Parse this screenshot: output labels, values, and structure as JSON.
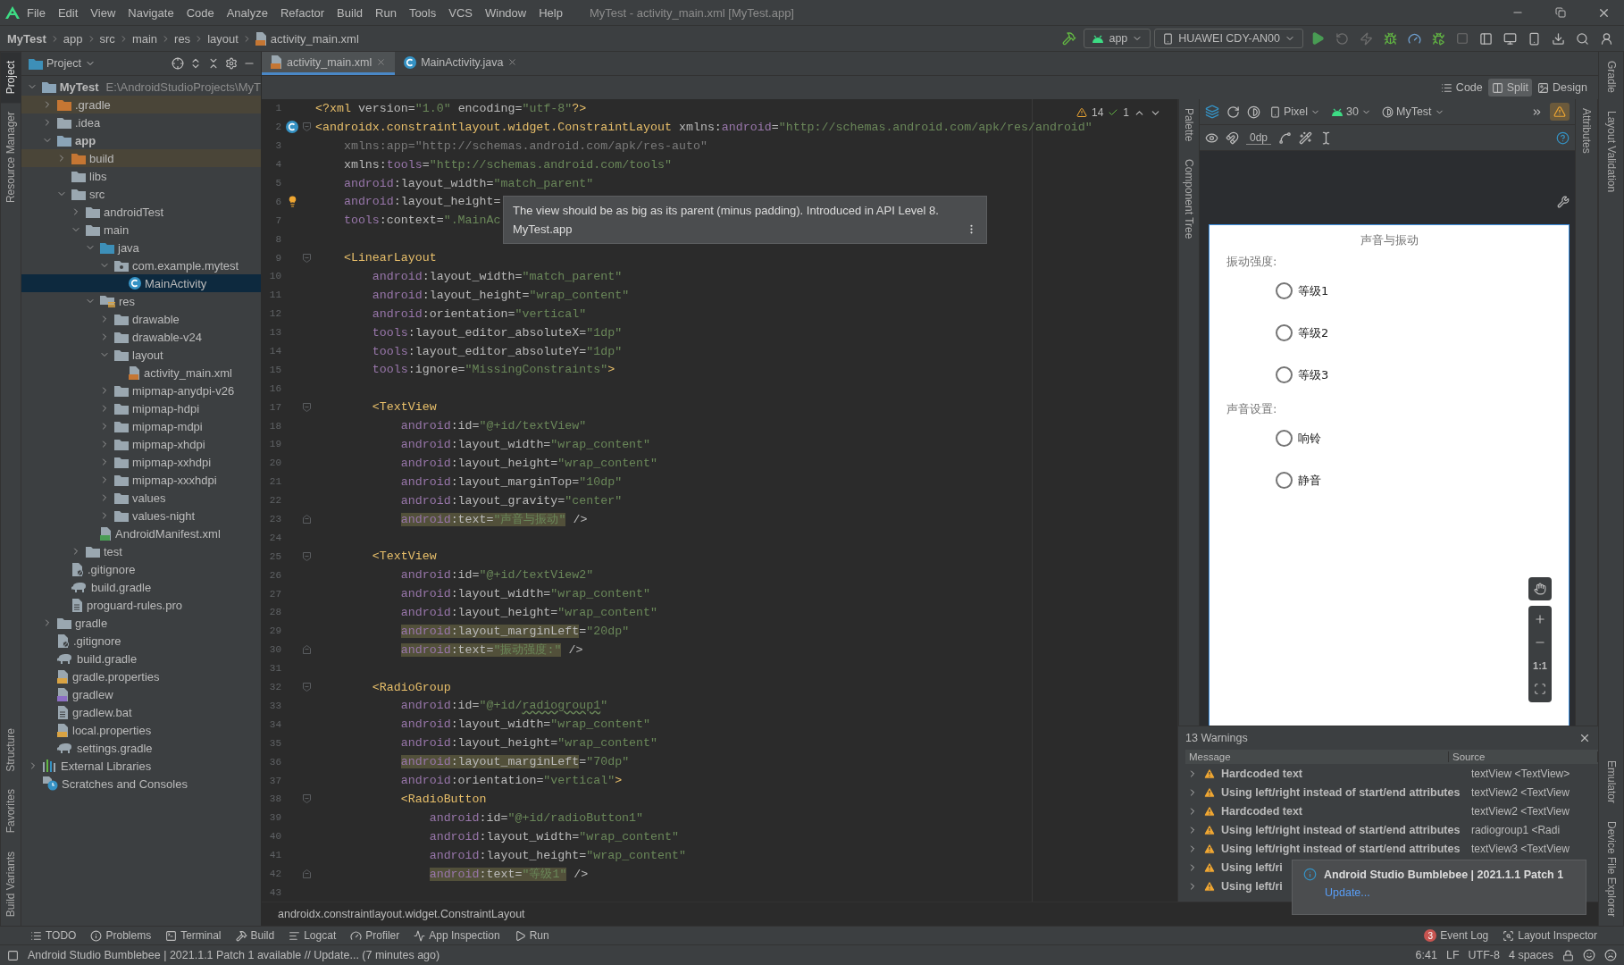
{
  "menu_bar": {
    "items": [
      "File",
      "Edit",
      "View",
      "Navigate",
      "Code",
      "Analyze",
      "Refactor",
      "Build",
      "Run",
      "Tools",
      "VCS",
      "Window",
      "Help"
    ],
    "title": "MyTest - activity_main.xml [MyTest.app]"
  },
  "nav_bar": {
    "breadcrumbs": [
      "MyTest",
      "app",
      "src",
      "main",
      "res",
      "layout",
      "activity_main.xml"
    ],
    "run_config": "app",
    "device": "HUAWEI CDY-AN00"
  },
  "left_stripe": {
    "top": [
      {
        "label": "Project",
        "selected": true
      },
      {
        "label": "Resource Manager",
        "selected": false
      }
    ],
    "bottom": [
      {
        "label": "Structure",
        "selected": false
      },
      {
        "label": "Favorites",
        "selected": false
      },
      {
        "label": "Build Variants",
        "selected": false
      }
    ]
  },
  "project": {
    "view": "Project",
    "tree": [
      {
        "label": "MyTest",
        "path": "E:\\AndroidStudioProjects\\MyT",
        "kind": "module",
        "selected": false,
        "expanded": true,
        "children": [
          {
            "label": ".gradle",
            "kind": "excluded",
            "selected": false,
            "expanded": false
          },
          {
            "label": ".idea",
            "kind": "folder",
            "selected": false,
            "expanded": false
          },
          {
            "label": "app",
            "kind": "module",
            "selected": false,
            "expanded": true,
            "children": [
              {
                "label": "build",
                "kind": "excluded",
                "selected": false,
                "expanded": false
              },
              {
                "label": "libs",
                "kind": "folder",
                "selected": false
              },
              {
                "label": "src",
                "kind": "folder",
                "selected": false,
                "expanded": true,
                "children": [
                  {
                    "label": "androidTest",
                    "kind": "folder",
                    "selected": false,
                    "expanded": false
                  },
                  {
                    "label": "main",
                    "kind": "folder",
                    "selected": false,
                    "expanded": true,
                    "children": [
                      {
                        "label": "java",
                        "kind": "source",
                        "selected": false,
                        "expanded": true,
                        "children": [
                          {
                            "label": "com.example.mytest",
                            "kind": "package",
                            "selected": false,
                            "expanded": true,
                            "children": [
                              {
                                "label": "MainActivity",
                                "kind": "class",
                                "selected": true
                              }
                            ]
                          }
                        ]
                      },
                      {
                        "label": "res",
                        "kind": "res",
                        "selected": false,
                        "expanded": true,
                        "children": [
                          {
                            "label": "drawable",
                            "kind": "folder",
                            "selected": false,
                            "expanded": false
                          },
                          {
                            "label": "drawable-v24",
                            "kind": "folder",
                            "selected": false,
                            "expanded": false
                          },
                          {
                            "label": "layout",
                            "kind": "folder",
                            "selected": false,
                            "expanded": true,
                            "children": [
                              {
                                "label": "activity_main.xml",
                                "kind": "xml",
                                "selected": false
                              }
                            ]
                          },
                          {
                            "label": "mipmap-anydpi-v26",
                            "kind": "folder",
                            "selected": false,
                            "expanded": false
                          },
                          {
                            "label": "mipmap-hdpi",
                            "kind": "folder",
                            "selected": false,
                            "expanded": false
                          },
                          {
                            "label": "mipmap-mdpi",
                            "kind": "folder",
                            "selected": false,
                            "expanded": false
                          },
                          {
                            "label": "mipmap-xhdpi",
                            "kind": "folder",
                            "selected": false,
                            "expanded": false
                          },
                          {
                            "label": "mipmap-xxhdpi",
                            "kind": "folder",
                            "selected": false,
                            "expanded": false
                          },
                          {
                            "label": "mipmap-xxxhdpi",
                            "kind": "folder",
                            "selected": false,
                            "expanded": false
                          },
                          {
                            "label": "values",
                            "kind": "folder",
                            "selected": false,
                            "expanded": false
                          },
                          {
                            "label": "values-night",
                            "kind": "folder",
                            "selected": false,
                            "expanded": false
                          }
                        ]
                      },
                      {
                        "label": "AndroidManifest.xml",
                        "kind": "manifest",
                        "selected": false
                      }
                    ]
                  },
                  {
                    "label": "test",
                    "kind": "folder",
                    "selected": false,
                    "expanded": false
                  }
                ]
              },
              {
                "label": ".gitignore",
                "kind": "gitignore",
                "selected": false
              },
              {
                "label": "build.gradle",
                "kind": "gradle",
                "selected": false
              },
              {
                "label": "proguard-rules.pro",
                "kind": "text",
                "selected": false
              }
            ]
          },
          {
            "label": "gradle",
            "kind": "folder",
            "selected": false,
            "expanded": false
          },
          {
            "label": ".gitignore",
            "kind": "gitignore",
            "selected": false
          },
          {
            "label": "build.gradle",
            "kind": "gradle",
            "selected": false
          },
          {
            "label": "gradle.properties",
            "kind": "properties",
            "selected": false
          },
          {
            "label": "gradlew",
            "kind": "script",
            "selected": false
          },
          {
            "label": "gradlew.bat",
            "kind": "text",
            "selected": false
          },
          {
            "label": "local.properties",
            "kind": "properties",
            "selected": false
          },
          {
            "label": "settings.gradle",
            "kind": "gradle",
            "selected": false
          }
        ]
      },
      {
        "label": "External Libraries",
        "kind": "libraries",
        "selected": false,
        "expanded": false
      },
      {
        "label": "Scratches and Consoles",
        "kind": "scratches",
        "selected": false
      }
    ]
  },
  "editor": {
    "tabs": [
      {
        "label": "activity_main.xml",
        "kind": "xml",
        "selected": true
      },
      {
        "label": "MainActivity.java",
        "kind": "class",
        "selected": false
      }
    ],
    "modes": [
      {
        "label": "Code",
        "kind": "code",
        "selected": false
      },
      {
        "label": "Split",
        "kind": "split",
        "selected": true
      },
      {
        "label": "Design",
        "kind": "design",
        "selected": false
      }
    ],
    "inspections": {
      "warnings": "14",
      "passed": "1"
    },
    "lines": [
      {
        "number": "1",
        "tokens": [
          {
            "kind": "tag",
            "text": "<?xml"
          },
          {
            "kind": "attr",
            "text": " version="
          },
          {
            "kind": "str",
            "text": "\"1.0\""
          },
          {
            "kind": "attr",
            "text": " encoding="
          },
          {
            "kind": "str",
            "text": "\"utf-8\""
          },
          {
            "kind": "tag",
            "text": "?>"
          }
        ]
      },
      {
        "number": "2",
        "gutter": {
          "kind": "class"
        },
        "fold": {
          "kind": "start"
        },
        "tokens": [
          {
            "kind": "tag",
            "text": "<androidx.constraintlayout.widget.ConstraintLayout"
          },
          {
            "kind": "attr",
            "text": " xmlns:"
          },
          {
            "kind": "ns",
            "text": "android"
          },
          {
            "kind": "attr",
            "text": "="
          },
          {
            "kind": "str",
            "text": "\"http://schemas.android.com/apk/res/android\""
          }
        ]
      },
      {
        "number": "3",
        "tokens": [
          {
            "kind": "dim",
            "text": "    xmlns:app=\"http://schemas.android.com/apk/res-auto\""
          }
        ]
      },
      {
        "number": "4",
        "tokens": [
          {
            "kind": "attr",
            "text": "    xmlns:"
          },
          {
            "kind": "ns",
            "text": "tools"
          },
          {
            "kind": "attr",
            "text": "="
          },
          {
            "kind": "str",
            "text": "\"http://schemas.android.com/tools\""
          }
        ]
      },
      {
        "number": "5",
        "tokens": [
          {
            "kind": "ns",
            "text": "    android"
          },
          {
            "kind": "attr",
            "text": ":layout_width="
          },
          {
            "kind": "str",
            "text": "\"match_parent\""
          }
        ]
      },
      {
        "number": "6",
        "gutter": {
          "kind": "bulb"
        },
        "tokens": [
          {
            "kind": "ns",
            "text": "    android"
          },
          {
            "kind": "attr",
            "text": ":layout_height="
          }
        ]
      },
      {
        "number": "7",
        "tokens": [
          {
            "kind": "ns",
            "text": "    tools"
          },
          {
            "kind": "attr",
            "text": ":context="
          },
          {
            "kind": "str",
            "text": "\".MainAc"
          }
        ]
      },
      {
        "number": "8"
      },
      {
        "number": "9",
        "fold": {
          "kind": "start"
        },
        "tokens": [
          {
            "kind": "tag",
            "text": "    <LinearLayout"
          }
        ]
      },
      {
        "number": "10",
        "tokens": [
          {
            "kind": "ns",
            "text": "        android"
          },
          {
            "kind": "attr",
            "text": ":layout_width="
          },
          {
            "kind": "str",
            "text": "\"match_parent\""
          }
        ]
      },
      {
        "number": "11",
        "tokens": [
          {
            "kind": "ns",
            "text": "        android"
          },
          {
            "kind": "attr",
            "text": ":layout_height="
          },
          {
            "kind": "str",
            "text": "\"wrap_content\""
          }
        ]
      },
      {
        "number": "12",
        "tokens": [
          {
            "kind": "ns",
            "text": "        android"
          },
          {
            "kind": "attr",
            "text": ":orientation="
          },
          {
            "kind": "str",
            "text": "\"vertical\""
          }
        ]
      },
      {
        "number": "13",
        "tokens": [
          {
            "kind": "ns",
            "text": "        tools"
          },
          {
            "kind": "attr",
            "text": ":layout_editor_absoluteX="
          },
          {
            "kind": "str",
            "text": "\"1dp\""
          }
        ]
      },
      {
        "number": "14",
        "tokens": [
          {
            "kind": "ns",
            "text": "        tools"
          },
          {
            "kind": "attr",
            "text": ":layout_editor_absoluteY="
          },
          {
            "kind": "str",
            "text": "\"1dp\""
          }
        ]
      },
      {
        "number": "15",
        "tokens": [
          {
            "kind": "ns",
            "text": "        tools"
          },
          {
            "kind": "attr",
            "text": ":ignore="
          },
          {
            "kind": "str",
            "text": "\"MissingConstraints\""
          },
          {
            "kind": "tag",
            "text": ">"
          }
        ]
      },
      {
        "number": "16"
      },
      {
        "number": "17",
        "fold": {
          "kind": "start"
        },
        "tokens": [
          {
            "kind": "tag",
            "text": "        <TextView"
          }
        ]
      },
      {
        "number": "18",
        "tokens": [
          {
            "kind": "ns",
            "text": "            android"
          },
          {
            "kind": "attr",
            "text": ":id="
          },
          {
            "kind": "str",
            "text": "\"@+id/textView\""
          }
        ]
      },
      {
        "number": "19",
        "tokens": [
          {
            "kind": "ns",
            "text": "            android"
          },
          {
            "kind": "attr",
            "text": ":layout_width="
          },
          {
            "kind": "str",
            "text": "\"wrap_content\""
          }
        ]
      },
      {
        "number": "20",
        "tokens": [
          {
            "kind": "ns",
            "text": "            android"
          },
          {
            "kind": "attr",
            "text": ":layout_height="
          },
          {
            "kind": "str",
            "text": "\"wrap_content\""
          }
        ]
      },
      {
        "number": "21",
        "tokens": [
          {
            "kind": "ns",
            "text": "            android"
          },
          {
            "kind": "attr",
            "text": ":layout_marginTop="
          },
          {
            "kind": "str",
            "text": "\"10dp\""
          }
        ]
      },
      {
        "number": "22",
        "tokens": [
          {
            "kind": "ns",
            "text": "            android"
          },
          {
            "kind": "attr",
            "text": ":layout_gravity="
          },
          {
            "kind": "str",
            "text": "\"center\""
          }
        ]
      },
      {
        "number": "23",
        "fold": {
          "kind": "end"
        },
        "tokens": [
          {
            "kind": "nsmark",
            "text": "            android"
          },
          {
            "kind": "attrmark",
            "text": ":text="
          },
          {
            "kind": "strmark",
            "text": "\"声音与振动\""
          },
          {
            "kind": "attr",
            "text": " />"
          }
        ]
      },
      {
        "number": "24"
      },
      {
        "number": "25",
        "fold": {
          "kind": "start"
        },
        "tokens": [
          {
            "kind": "tag",
            "text": "        <TextView"
          }
        ]
      },
      {
        "number": "26",
        "tokens": [
          {
            "kind": "ns",
            "text": "            android"
          },
          {
            "kind": "attr",
            "text": ":id="
          },
          {
            "kind": "str",
            "text": "\"@+id/textView2\""
          }
        ]
      },
      {
        "number": "27",
        "tokens": [
          {
            "kind": "ns",
            "text": "            android"
          },
          {
            "kind": "attr",
            "text": ":layout_width="
          },
          {
            "kind": "str",
            "text": "\"wrap_content\""
          }
        ]
      },
      {
        "number": "28",
        "tokens": [
          {
            "kind": "ns",
            "text": "            android"
          },
          {
            "kind": "attr",
            "text": ":layout_height="
          },
          {
            "kind": "str",
            "text": "\"wrap_content\""
          }
        ]
      },
      {
        "number": "29",
        "tokens": [
          {
            "kind": "nsmark",
            "text": "            android"
          },
          {
            "kind": "attrmark",
            "text": ":layout_marginLeft"
          },
          {
            "kind": "attr",
            "text": "="
          },
          {
            "kind": "str",
            "text": "\"20dp\""
          }
        ]
      },
      {
        "number": "30",
        "fold": {
          "kind": "end"
        },
        "tokens": [
          {
            "kind": "nsmark",
            "text": "            android"
          },
          {
            "kind": "attrmark",
            "text": ":text="
          },
          {
            "kind": "strmark",
            "text": "\"振动强度:\""
          },
          {
            "kind": "attr",
            "text": " />"
          }
        ]
      },
      {
        "number": "31"
      },
      {
        "number": "32",
        "fold": {
          "kind": "start"
        },
        "tokens": [
          {
            "kind": "tag",
            "text": "        <RadioGroup"
          }
        ]
      },
      {
        "number": "33",
        "tokens": [
          {
            "kind": "ns",
            "text": "            android"
          },
          {
            "kind": "attr",
            "text": ":id="
          },
          {
            "kind": "str",
            "text": "\"@+id/"
          },
          {
            "kind": "strtypo",
            "text": "radiogroup1"
          },
          {
            "kind": "str",
            "text": "\""
          }
        ]
      },
      {
        "number": "34",
        "tokens": [
          {
            "kind": "ns",
            "text": "            android"
          },
          {
            "kind": "attr",
            "text": ":layout_width="
          },
          {
            "kind": "str",
            "text": "\"wrap_content\""
          }
        ]
      },
      {
        "number": "35",
        "tokens": [
          {
            "kind": "ns",
            "text": "            android"
          },
          {
            "kind": "attr",
            "text": ":layout_height="
          },
          {
            "kind": "str",
            "text": "\"wrap_content\""
          }
        ]
      },
      {
        "number": "36",
        "tokens": [
          {
            "kind": "nsmark",
            "text": "            android"
          },
          {
            "kind": "attrmark",
            "text": ":layout_marginLeft"
          },
          {
            "kind": "attr",
            "text": "="
          },
          {
            "kind": "str",
            "text": "\"70dp\""
          }
        ]
      },
      {
        "number": "37",
        "tokens": [
          {
            "kind": "ns",
            "text": "            android"
          },
          {
            "kind": "attr",
            "text": ":orientation="
          },
          {
            "kind": "str",
            "text": "\"vertical\""
          },
          {
            "kind": "tag",
            "text": ">"
          }
        ]
      },
      {
        "number": "38",
        "fold": {
          "kind": "start"
        },
        "tokens": [
          {
            "kind": "tag",
            "text": "            <RadioButton"
          }
        ]
      },
      {
        "number": "39",
        "tokens": [
          {
            "kind": "ns",
            "text": "                android"
          },
          {
            "kind": "attr",
            "text": ":id="
          },
          {
            "kind": "str",
            "text": "\"@+id/radioButton1\""
          }
        ]
      },
      {
        "number": "40",
        "tokens": [
          {
            "kind": "ns",
            "text": "                android"
          },
          {
            "kind": "attr",
            "text": ":layout_width="
          },
          {
            "kind": "str",
            "text": "\"wrap_content\""
          }
        ]
      },
      {
        "number": "41",
        "tokens": [
          {
            "kind": "ns",
            "text": "                android"
          },
          {
            "kind": "attr",
            "text": ":layout_height="
          },
          {
            "kind": "str",
            "text": "\"wrap_content\""
          }
        ]
      },
      {
        "number": "42",
        "fold": {
          "kind": "end"
        },
        "tokens": [
          {
            "kind": "nsmark",
            "text": "                android"
          },
          {
            "kind": "attrmark",
            "text": ":text="
          },
          {
            "kind": "strmark",
            "text": "\"等级1\""
          },
          {
            "kind": "attr",
            "text": " />"
          }
        ]
      },
      {
        "number": "43"
      }
    ],
    "tooltip": {
      "text": "The view should be as big as its parent (minus padding). Introduced in API Level 8.",
      "source": "MyTest.app"
    },
    "footer": "androidx.constraintlayout.widget.ConstraintLayout"
  },
  "design": {
    "palette_stripe": [
      {
        "label": "Palette",
        "selected": false
      },
      {
        "label": "Component Tree",
        "selected": false
      }
    ],
    "attributes_stripe": [
      {
        "label": "Attributes",
        "selected": false
      }
    ],
    "toolbar": {
      "device": "Pixel",
      "api": "30",
      "theme": "MyTest",
      "margin": "0dp"
    },
    "preview": {
      "title": "声音与振动",
      "groups": [
        {
          "label": "振动强度:",
          "options": [
            {
              "text": "等级1",
              "selected": false
            },
            {
              "text": "等级2",
              "selected": false
            },
            {
              "text": "等级3",
              "selected": false
            }
          ]
        },
        {
          "label": "声音设置:",
          "options": [
            {
              "text": "响铃",
              "selected": false
            },
            {
              "text": "静音",
              "selected": false
            }
          ]
        }
      ]
    },
    "zoom_controls": {
      "actual_size": "1:1"
    }
  },
  "warnings": {
    "title": "13 Warnings",
    "columns": [
      "Message",
      "Source"
    ],
    "rows": [
      {
        "kind": "warning",
        "message": "Hardcoded text",
        "source": "textView <TextView>"
      },
      {
        "kind": "warning",
        "message": "Using left/right instead of start/end attributes",
        "source": "textView2 <TextView"
      },
      {
        "kind": "warning",
        "message": "Hardcoded text",
        "source": "textView2 <TextView"
      },
      {
        "kind": "warning",
        "message": "Using left/right instead of start/end attributes",
        "source": "radiogroup1 <Radi"
      },
      {
        "kind": "warning",
        "message": "Using left/right instead of start/end attributes",
        "source": "textView3 <TextView"
      },
      {
        "kind": "warning",
        "message": "Using left/ri"
      },
      {
        "kind": "warning",
        "message": "Using left/ri"
      }
    ]
  },
  "right_stripe": {
    "top": [
      {
        "label": "Gradle",
        "selected": false
      },
      {
        "label": "Layout Validation",
        "selected": false
      }
    ],
    "bottom": [
      {
        "label": "Emulator",
        "selected": false
      },
      {
        "label": "Device File Explorer",
        "selected": false
      }
    ]
  },
  "notification": {
    "title": "Android Studio Bumblebee | 2021.1.1 Patch 1",
    "link": "Update..."
  },
  "bottom_toolbar": {
    "left": [
      {
        "label": "TODO",
        "kind": "todo"
      },
      {
        "label": "Problems",
        "kind": "problems"
      },
      {
        "label": "Terminal",
        "kind": "terminal"
      },
      {
        "label": "Build",
        "kind": "build"
      },
      {
        "label": "Logcat",
        "kind": "logcat"
      },
      {
        "label": "Profiler",
        "kind": "profiler"
      },
      {
        "label": "App Inspection",
        "kind": "inspection"
      },
      {
        "label": "Run",
        "kind": "run"
      }
    ],
    "right": [
      {
        "label": "Event Log",
        "kind": "eventlog",
        "badge": "3"
      },
      {
        "label": "Layout Inspector",
        "kind": "layoutinspector"
      }
    ]
  },
  "status_bar": {
    "message": "Android Studio Bumblebee | 2021.1.1 Patch 1 available // Update... (7 minutes ago)",
    "position": "6:41",
    "line_separator": "LF",
    "encoding": "UTF-8",
    "indent": "4 spaces"
  }
}
